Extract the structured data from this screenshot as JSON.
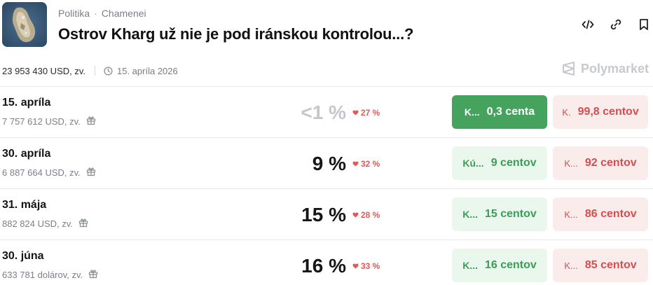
{
  "header": {
    "category": "Politika",
    "separator": "·",
    "subcategory": "Chamenei",
    "title": "Ostrov Kharg už nie je pod iránskou kontrolou...?",
    "actions": [
      {
        "icon": "code-embed-icon"
      },
      {
        "icon": "link-icon"
      },
      {
        "icon": "bookmark-icon"
      }
    ]
  },
  "meta": {
    "volume": "23 953 430 USD, zv.",
    "end_date": "15. apríla 2026",
    "brand": "Polymarket"
  },
  "markets": [
    {
      "date": "15. apríla",
      "volume": "7 757 612 USD, zv.",
      "probability": "<1 %",
      "change": "27 %",
      "change_dir": "down",
      "yes_label": "K...",
      "yes_price": "0,3 centa",
      "no_label": "K.",
      "no_price": "99,8 centov",
      "yes_active": true
    },
    {
      "date": "30. apríla",
      "volume": "6 887 664 USD, zv.",
      "probability": "9 %",
      "change": "32 %",
      "change_dir": "down",
      "yes_label": "Kú...",
      "yes_price": "9 centov",
      "no_label": "K...",
      "no_price": "92 centov",
      "yes_active": false
    },
    {
      "date": "31. mája",
      "volume": "882 824 USD, zv.",
      "probability": "15 %",
      "change": "28 %",
      "change_dir": "down",
      "yes_label": "K...",
      "yes_price": "15 centov",
      "no_label": "K...",
      "no_price": "86 centov",
      "yes_active": false
    },
    {
      "date": "30. júna",
      "volume": "633 781 dolárov, zv.",
      "probability": "16 %",
      "change": "33 %",
      "change_dir": "down",
      "yes_label": "K...",
      "yes_price": "16 centov",
      "no_label": "K...",
      "no_price": "85 centov",
      "yes_active": false
    }
  ],
  "colors": {
    "yes_active_bg": "#45a35d",
    "yes_bg": "#e9f7ec",
    "yes_text": "#3c9c57",
    "no_bg": "#fbecec",
    "no_text": "#d64d4d",
    "down": "#e05a5a"
  }
}
